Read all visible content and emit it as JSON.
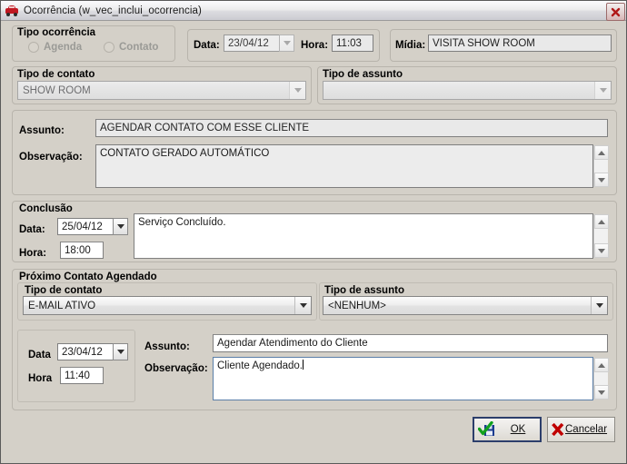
{
  "window": {
    "title": "Ocorrência (w_vec_inclui_ocorrencia)",
    "icon": "car-icon",
    "close_icon": "close-icon"
  },
  "tipo_ocorrencia": {
    "group_label": "Tipo ocorrência",
    "options": [
      {
        "label": "Agenda",
        "selected": false,
        "enabled": false
      },
      {
        "label": "Contato",
        "selected": false,
        "enabled": false
      }
    ],
    "data_label": "Data:",
    "data_value": "23/04/12",
    "hora_label": "Hora:",
    "hora_value": "11:03",
    "midia_label": "Mídia:",
    "midia_value": "VISITA SHOW ROOM"
  },
  "tipo_contato": {
    "label": "Tipo de contato",
    "value": "SHOW ROOM",
    "enabled": false
  },
  "tipo_assunto": {
    "label": "Tipo de assunto",
    "value": "",
    "enabled": false
  },
  "assunto": {
    "label": "Assunto:",
    "value": "AGENDAR CONTATO COM ESSE CLIENTE"
  },
  "observacao": {
    "label": "Observação:",
    "value": "CONTATO GERADO AUTOMÁTICO"
  },
  "conclusao": {
    "group_label": "Conclusão",
    "data_label": "Data:",
    "data_value": "25/04/12",
    "hora_label": "Hora:",
    "hora_value": "18:00",
    "texto": "Serviço Concluído."
  },
  "proximo_contato": {
    "group_label": "Próximo Contato Agendado",
    "tipo_contato_label": "Tipo de contato",
    "tipo_contato_value": "E-MAIL ATIVO",
    "tipo_assunto_label": "Tipo de assunto",
    "tipo_assunto_value": "<NENHUM>",
    "data_label": "Data",
    "data_value": "23/04/12",
    "hora_label": "Hora",
    "hora_value": "11:40",
    "assunto_label": "Assunto:",
    "assunto_value": "Agendar Atendimento do Cliente",
    "observacao_label": "Observação:",
    "observacao_value": "Cliente Agendado."
  },
  "footer": {
    "ok_label": "OK",
    "ok_icon": "save-check-icon",
    "cancel_label": "Cancelar",
    "cancel_icon": "red-x-icon"
  },
  "colors": {
    "window_bg": "#d4d0c8",
    "titlebar_top": "#fbfbfd",
    "titlebar_bottom": "#ccccd2",
    "ok_check_green": "#11a01e",
    "cancel_x_red": "#c00000",
    "focus_border": "#2c3e6b",
    "panel_border": "#b8b4ac"
  }
}
